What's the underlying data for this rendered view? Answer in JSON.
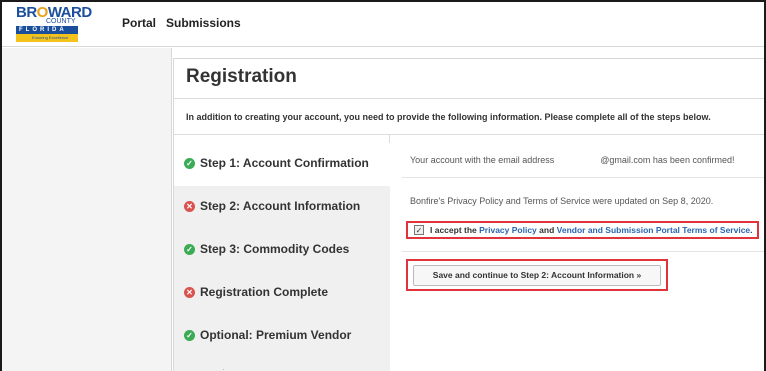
{
  "header": {
    "logo": {
      "brand_part1": "BR",
      "brand_part2": "WARD",
      "county": "COUNTY",
      "state": "FLORIDA",
      "tagline": "Ensuring Excellence"
    },
    "nav": [
      {
        "label": "Portal"
      },
      {
        "label": "Submissions"
      }
    ]
  },
  "registration": {
    "title": "Registration",
    "intro": "In addition to creating your account, you need to provide the following information. Please complete all of the steps below.",
    "steps": [
      {
        "label": "Step 1: Account Confirmation",
        "status": "complete",
        "icon": "check-circle-icon"
      },
      {
        "label": "Step 2: Account Information",
        "status": "incomplete",
        "icon": "x-circle-icon"
      },
      {
        "label": "Step 3: Commodity Codes",
        "status": "complete",
        "icon": "check-circle-icon"
      },
      {
        "label": "Registration Complete",
        "status": "incomplete",
        "icon": "x-circle-icon"
      },
      {
        "label": "Optional: Premium Vendor",
        "status": "complete",
        "icon": "check-circle-icon"
      }
    ],
    "confirmation": {
      "prefix": "Your account with the email address",
      "suffix": "@gmail.com has been confirmed!"
    },
    "policy_note": "Bonfire's Privacy Policy and Terms of Service were updated on Sep 8, 2020.",
    "accept": {
      "checked": true,
      "text_before": "I accept the ",
      "privacy_link": "Privacy Policy",
      "text_middle": " and ",
      "terms_link": "Vendor and Submission Portal Terms of Service",
      "text_after": "."
    },
    "save_button": "Save and continue to Step 2: Account Information »"
  },
  "colors": {
    "success": "#3bab55",
    "error": "#d9534f",
    "highlight": "#e0343a",
    "link": "#2a66b0"
  }
}
